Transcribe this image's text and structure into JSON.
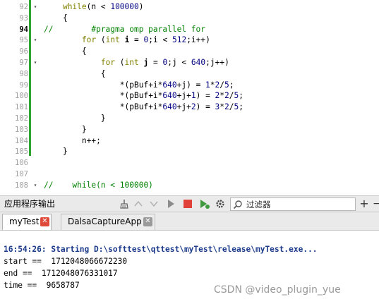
{
  "editor": {
    "lines": [
      {
        "num": "92",
        "fold": "▾",
        "indent": "    ",
        "tokens": [
          {
            "t": "while",
            "c": "kw"
          },
          {
            "t": "(n < "
          },
          {
            "t": "100000",
            "c": "num"
          },
          {
            "t": ")"
          }
        ]
      },
      {
        "num": "93",
        "fold": "",
        "indent": "    ",
        "tokens": [
          {
            "t": "{"
          }
        ]
      },
      {
        "num": "94",
        "fold": "",
        "indent": "",
        "current": true,
        "tokens": [
          {
            "t": "//        #pragma omp parallel for",
            "c": "cmt"
          }
        ]
      },
      {
        "num": "95",
        "fold": "▾",
        "indent": "        ",
        "tokens": [
          {
            "t": "for",
            "c": "kw"
          },
          {
            "t": " ("
          },
          {
            "t": "int",
            "c": "kw"
          },
          {
            "t": " "
          },
          {
            "t": "i",
            "c": "bold"
          },
          {
            "t": " = "
          },
          {
            "t": "0",
            "c": "num"
          },
          {
            "t": ";i < "
          },
          {
            "t": "512",
            "c": "num"
          },
          {
            "t": ";i++)"
          }
        ]
      },
      {
        "num": "96",
        "fold": "",
        "indent": "        ",
        "tokens": [
          {
            "t": "{"
          }
        ]
      },
      {
        "num": "97",
        "fold": "▾",
        "indent": "            ",
        "tokens": [
          {
            "t": "for",
            "c": "kw"
          },
          {
            "t": " ("
          },
          {
            "t": "int",
            "c": "kw"
          },
          {
            "t": " "
          },
          {
            "t": "j",
            "c": "bold"
          },
          {
            "t": " = "
          },
          {
            "t": "0",
            "c": "num"
          },
          {
            "t": ";j < "
          },
          {
            "t": "640",
            "c": "num"
          },
          {
            "t": ";j++)"
          }
        ]
      },
      {
        "num": "98",
        "fold": "",
        "indent": "            ",
        "tokens": [
          {
            "t": "{"
          }
        ]
      },
      {
        "num": "99",
        "fold": "",
        "indent": "                ",
        "tokens": [
          {
            "t": "*(pBuf+i*"
          },
          {
            "t": "640",
            "c": "num"
          },
          {
            "t": "+j) = "
          },
          {
            "t": "1",
            "c": "num"
          },
          {
            "t": "*"
          },
          {
            "t": "2",
            "c": "num"
          },
          {
            "t": "/"
          },
          {
            "t": "5",
            "c": "num"
          },
          {
            "t": ";"
          }
        ]
      },
      {
        "num": "100",
        "fold": "",
        "indent": "                ",
        "tokens": [
          {
            "t": "*(pBuf+i*"
          },
          {
            "t": "640",
            "c": "num"
          },
          {
            "t": "+j+"
          },
          {
            "t": "1",
            "c": "num"
          },
          {
            "t": ") = "
          },
          {
            "t": "2",
            "c": "num"
          },
          {
            "t": "*"
          },
          {
            "t": "2",
            "c": "num"
          },
          {
            "t": "/"
          },
          {
            "t": "5",
            "c": "num"
          },
          {
            "t": ";"
          }
        ]
      },
      {
        "num": "101",
        "fold": "",
        "indent": "                ",
        "tokens": [
          {
            "t": "*(pBuf+i*"
          },
          {
            "t": "640",
            "c": "num"
          },
          {
            "t": "+j+"
          },
          {
            "t": "2",
            "c": "num"
          },
          {
            "t": ") = "
          },
          {
            "t": "3",
            "c": "num"
          },
          {
            "t": "*"
          },
          {
            "t": "2",
            "c": "num"
          },
          {
            "t": "/"
          },
          {
            "t": "5",
            "c": "num"
          },
          {
            "t": ";"
          }
        ]
      },
      {
        "num": "102",
        "fold": "",
        "indent": "            ",
        "tokens": [
          {
            "t": "}"
          }
        ]
      },
      {
        "num": "103",
        "fold": "",
        "indent": "        ",
        "tokens": [
          {
            "t": "}"
          }
        ]
      },
      {
        "num": "104",
        "fold": "",
        "indent": "        ",
        "tokens": [
          {
            "t": "n++;"
          }
        ]
      },
      {
        "num": "105",
        "fold": "",
        "indent": "    ",
        "tokens": [
          {
            "t": "}"
          }
        ]
      },
      {
        "num": "106",
        "fold": "",
        "indent": "",
        "tokens": []
      },
      {
        "num": "107",
        "fold": "",
        "indent": "",
        "tokens": []
      },
      {
        "num": "108",
        "fold": "▾",
        "indent": "",
        "tokens": [
          {
            "t": "//    while(n < 100000)",
            "c": "cmt"
          }
        ]
      }
    ]
  },
  "output_pane": {
    "title": "应用程序输出",
    "toolbar_icons": [
      "broom-icon",
      "arrow-up-icon",
      "arrow-down-icon",
      "run-icon",
      "stop-icon",
      "debug-run-icon",
      "gear-icon"
    ],
    "filter": {
      "placeholder": "过滤器"
    },
    "add_label": "+",
    "minimize_label": "−",
    "tabs": [
      {
        "label": "myTest",
        "active": true
      },
      {
        "label": "DalsaCaptureApp",
        "active": false
      }
    ],
    "lines": [
      {
        "text": "16:54:26: Starting D:\\softtest\\qttest\\myTest\\release\\myTest.exe...",
        "kind": "start"
      },
      {
        "text": "start ==  1712048066672230",
        "kind": "normal"
      },
      {
        "text": "end ==  1712048076331017",
        "kind": "normal"
      },
      {
        "text": "time ==  9658787",
        "kind": "normal"
      }
    ],
    "watermark": "CSDN @video_plugin_yue"
  }
}
